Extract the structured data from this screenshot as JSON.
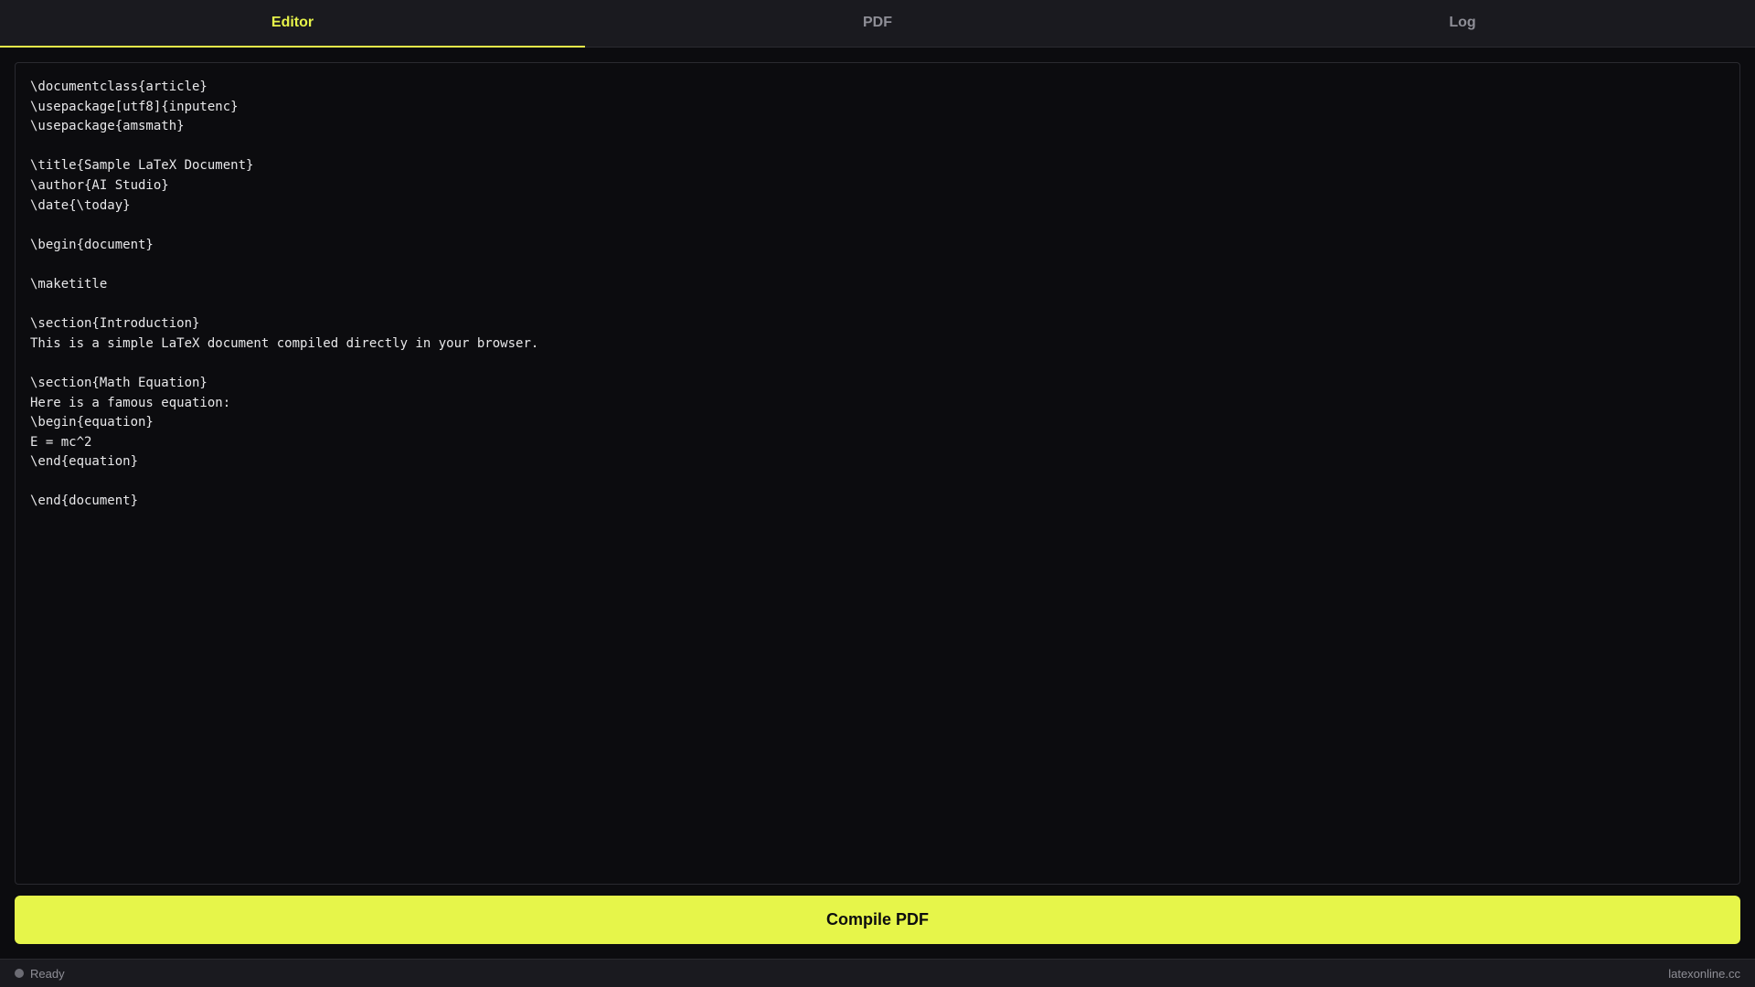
{
  "tabs": [
    {
      "label": "Editor",
      "active": true
    },
    {
      "label": "PDF",
      "active": false
    },
    {
      "label": "Log",
      "active": false
    }
  ],
  "editor": {
    "content": "\\documentclass{article}\n\\usepackage[utf8]{inputenc}\n\\usepackage{amsmath}\n\n\\title{Sample LaTeX Document}\n\\author{AI Studio}\n\\date{\\today}\n\n\\begin{document}\n\n\\maketitle\n\n\\section{Introduction}\nThis is a simple LaTeX document compiled directly in your browser.\n\n\\section{Math Equation}\nHere is a famous equation:\n\\begin{equation}\nE = mc^2\n\\end{equation}\n\n\\end{document}"
  },
  "compile_button": {
    "label": "Compile PDF"
  },
  "status": {
    "text": "Ready",
    "site": "latexonline.cc"
  },
  "colors": {
    "accent": "#e6f54a",
    "background": "#0c0c0f",
    "bar": "#1a1a1f",
    "muted_text": "#8e8e96"
  }
}
